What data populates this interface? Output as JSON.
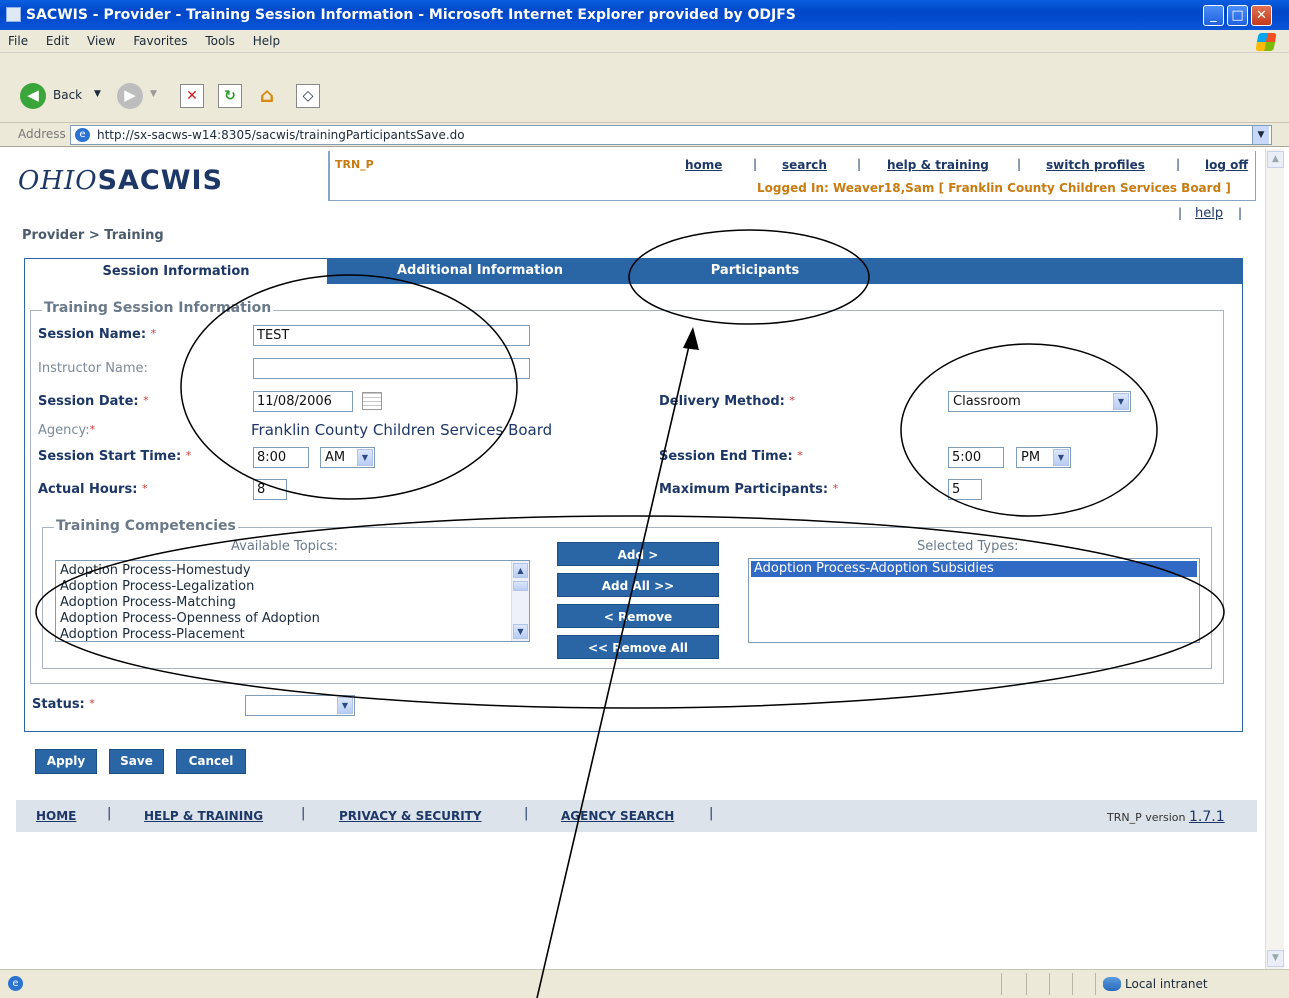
{
  "window": {
    "title": "SACWIS - Provider - Training Session Information - Microsoft Internet Explorer provided by ODJFS",
    "buttons": {
      "minimize": "_",
      "maximize": "□",
      "close": "✕"
    }
  },
  "menu": [
    "File",
    "Edit",
    "View",
    "Favorites",
    "Tools",
    "Help"
  ],
  "toolbar": {
    "back_label": "Back"
  },
  "address": {
    "label": "Address",
    "url": "http://sx-sacws-w14:8305/sacwis/trainingParticipantsSave.do"
  },
  "header": {
    "logo_script": "OHIO",
    "logo_bold": "SACWIS",
    "page_code": "TRN_P",
    "links": [
      "home",
      "search",
      "help & training",
      "switch profiles",
      "log off"
    ],
    "logged_in": "Logged In:  Weaver18,Sam [ Franklin County Children Services Board ]",
    "help": "help"
  },
  "breadcrumb": "Provider > Training",
  "tabs": [
    "Session Information",
    "Additional Information",
    "Participants"
  ],
  "form": {
    "legend": "Training Session Information",
    "session_name_label": "Session Name:",
    "session_name_value": "TEST",
    "instructor_label": "Instructor Name:",
    "instructor_value": "",
    "session_date_label": "Session Date:",
    "session_date_value": "11/08/2006",
    "agency_label": "Agency:",
    "agency_value": "Franklin County Children Services Board",
    "start_time_label": "Session Start Time:",
    "start_time_value": "8:00",
    "start_ampm": "AM",
    "actual_hours_label": "Actual Hours:",
    "actual_hours_value": "8",
    "delivery_label": "Delivery Method:",
    "delivery_value": "Classroom",
    "end_time_label": "Session End Time:",
    "end_time_value": "5:00",
    "end_ampm": "PM",
    "max_participants_label": "Maximum Participants:",
    "max_participants_value": "5",
    "required_marker": "*"
  },
  "competencies": {
    "legend": "Training Competencies",
    "available_label": "Available Topics:",
    "selected_label": "Selected Types:",
    "available": [
      "Adoption Process-Homestudy",
      "Adoption Process-Legalization",
      "Adoption Process-Matching",
      "Adoption Process-Openness of Adoption",
      "Adoption Process-Placement"
    ],
    "selected": [
      "Adoption Process-Adoption Subsidies"
    ],
    "buttons": {
      "add": "Add >",
      "add_all": "Add All >>",
      "remove": "< Remove",
      "remove_all": "<< Remove All"
    }
  },
  "status": {
    "label": "Status:",
    "value": ""
  },
  "actions": {
    "apply": "Apply",
    "save": "Save",
    "cancel": "Cancel"
  },
  "footer": {
    "links": [
      "HOME",
      "HELP & TRAINING",
      "PRIVACY & SECURITY",
      "AGENCY SEARCH"
    ],
    "version_prefix": "TRN_P version",
    "version": "1.7.1"
  },
  "statusbar": {
    "zone": "Local intranet"
  },
  "colors": {
    "tab_blue": "#2a66a6",
    "navy_text": "#1d3766",
    "orange_text": "#c77b10",
    "required_red": "#d03a3a"
  }
}
